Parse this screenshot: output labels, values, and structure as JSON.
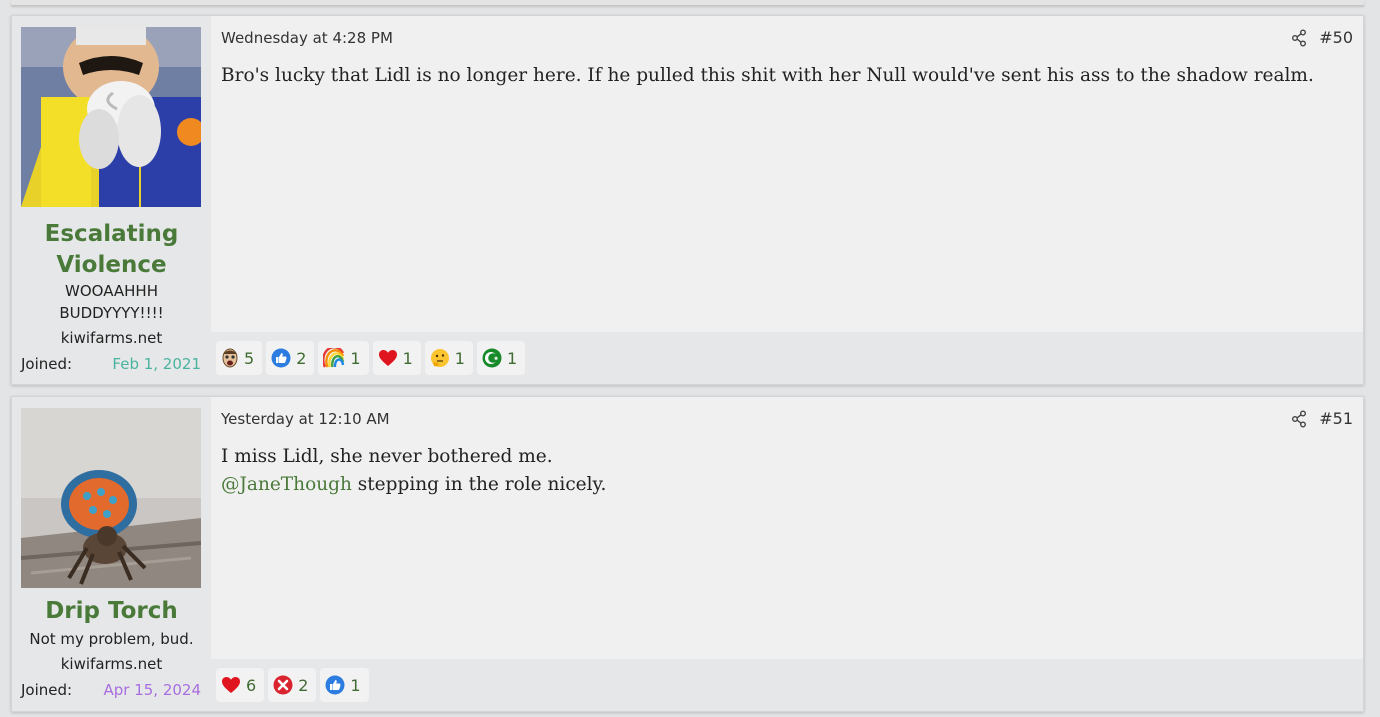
{
  "posts": [
    {
      "author": "Escalating Violence",
      "user_title": "WOOAAHHH BUDDYYYY!!!!",
      "site": "kiwifarms.net",
      "joined_label": "Joined:",
      "joined_date": "Feb 1, 2021",
      "date": "Wednesday at 4:28 PM",
      "number": "#50",
      "body": "Bro's lucky that Lidl is no longer here. If he pulled this shit with her Null would've sent his ass to the shadow realm.",
      "reactions": [
        {
          "icon": "soyjak-face-icon",
          "count": "5"
        },
        {
          "icon": "thumbs-up-icon",
          "count": "2"
        },
        {
          "icon": "rainbow-icon",
          "count": "1"
        },
        {
          "icon": "heart-icon",
          "count": "1"
        },
        {
          "icon": "thinking-face-icon",
          "count": "1"
        },
        {
          "icon": "islam-crescent-icon",
          "count": "1"
        }
      ]
    },
    {
      "author": "Drip Torch",
      "user_title": "Not my problem, bud.",
      "site": "kiwifarms.net",
      "joined_label": "Joined:",
      "joined_date": "Apr 15, 2024",
      "date": "Yesterday at 12:10 AM",
      "number": "#51",
      "body_line1": "I miss Lidl, she never bothered me.",
      "mention": "@JaneThough",
      "body_line2_rest": " stepping in the role nicely.",
      "reactions": [
        {
          "icon": "heart-icon",
          "count": "6"
        },
        {
          "icon": "red-x-icon",
          "count": "2"
        },
        {
          "icon": "thumbs-up-icon",
          "count": "1"
        }
      ]
    }
  ],
  "colors": {
    "username": "#4a7a3a",
    "joined_teal": "#4ab3a0",
    "joined_purple": "#a86ee0",
    "reaction_count": "#3f6c32"
  }
}
